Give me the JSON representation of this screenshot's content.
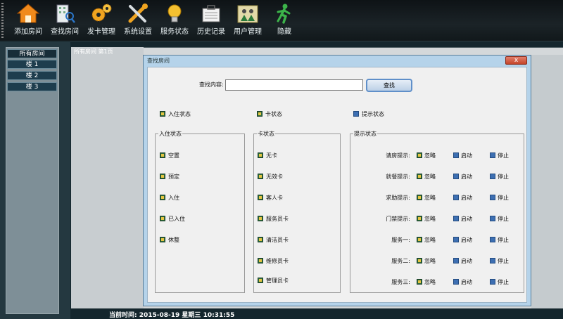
{
  "toolbar": {
    "buttons": [
      {
        "label": "添加房间",
        "icon": "house-icon"
      },
      {
        "label": "查找房间",
        "icon": "building-search-icon"
      },
      {
        "label": "发卡管理",
        "icon": "gears-icon"
      },
      {
        "label": "系统设置",
        "icon": "tools-icon"
      },
      {
        "label": "服务状态",
        "icon": "lightbulb-icon"
      },
      {
        "label": "历史记录",
        "icon": "briefcase-icon"
      },
      {
        "label": "用户管理",
        "icon": "users-icon"
      },
      {
        "label": "隐藏",
        "icon": "running-man-icon"
      }
    ]
  },
  "sidebar": {
    "title": "所有房间",
    "items": [
      {
        "label": "楼 1"
      },
      {
        "label": "楼 2"
      },
      {
        "label": "楼 3"
      }
    ]
  },
  "main": {
    "header": "所有房间 第1页"
  },
  "status": {
    "text": "当前时间: 2015-08-19 星期三 10:31:55"
  },
  "dialog": {
    "title": "查找房间",
    "close_label": "x",
    "search": {
      "label": "查找内容:",
      "value": "",
      "button_label": "查找"
    },
    "top_checks": [
      {
        "label": "入住状态",
        "checked": true
      },
      {
        "label": "卡状态",
        "checked": true
      },
      {
        "label": "提示状态",
        "checked": false
      }
    ],
    "checkin_group": {
      "title": "入住状态",
      "items": [
        {
          "label": "空置",
          "checked": true
        },
        {
          "label": "预定",
          "checked": true
        },
        {
          "label": "入住",
          "checked": true
        },
        {
          "label": "已入住",
          "checked": true
        },
        {
          "label": "休整",
          "checked": true
        }
      ]
    },
    "card_group": {
      "title": "卡状态",
      "items": [
        {
          "label": "无卡",
          "checked": true
        },
        {
          "label": "无效卡",
          "checked": true
        },
        {
          "label": "客人卡",
          "checked": true
        },
        {
          "label": "服务员卡",
          "checked": true
        },
        {
          "label": "清洁员卡",
          "checked": true
        },
        {
          "label": "维修员卡",
          "checked": true
        },
        {
          "label": "管理员卡",
          "checked": true
        }
      ]
    },
    "tip_group": {
      "title": "提示状态",
      "options": [
        "忽略",
        "启动",
        "停止"
      ],
      "rows": [
        {
          "label": "请房提示:"
        },
        {
          "label": "就餐提示:"
        },
        {
          "label": "求助提示:"
        },
        {
          "label": "门禁提示:"
        },
        {
          "label": "服务一:"
        },
        {
          "label": "服务二:"
        },
        {
          "label": "服务三:"
        }
      ]
    }
  }
}
